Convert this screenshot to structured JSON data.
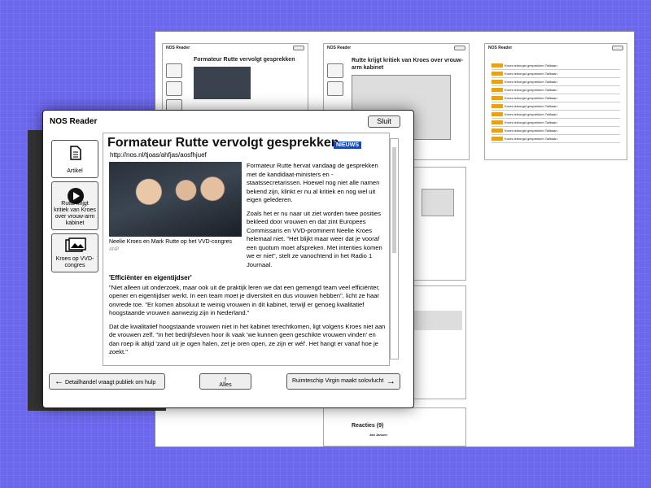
{
  "app": {
    "title": "NOS Reader",
    "close_label": "Sluit"
  },
  "sidebar": {
    "items": [
      {
        "label": "Artikel",
        "icon": "document-icon"
      },
      {
        "label": "Rutte krijgt kritiek van Kroes over vrouw-arm kabinet",
        "icon": "play-icon"
      },
      {
        "label": "Kroes op VVD-congres",
        "icon": "photos-icon"
      }
    ]
  },
  "article": {
    "title": "Formateur Rutte vervolgt gesprekken",
    "tag": "NIEUWS",
    "url": "http://nos.nl/tjoas/ahfjas/aosfhjuef",
    "caption": "Neelie Kroes en Mark Rutte op het VVD-congres",
    "source": "ANP",
    "p1": "Formateur Rutte hervat vandaag de gesprekken met de kandidaat-ministers en -staatssecretarissen. Hoewel nog niet alle namen bekend zijn, klinkt er nu al kritiek en nog wel uit eigen gelederen.",
    "p2": "Zoals het er nu naar uit ziet worden twee posities bekleed door vrouwen en dat zint Europees Commissaris en VVD-prominent Neelie Kroes helemaal niet. \"Het blijkt maar weer dat je vooraf een quotum moet afspreken. Met intenties komen we er niet\", stelt ze vanochtend in het Radio 1 Journaal.",
    "subhead": "'Efficiënter en eigentijdser'",
    "p3": "\"Niet alleen uit onderzoek, maar ook uit de praktijk leren we dat een gemengd team veel efficiënter, opener en eigentijdser werkt. In een team moet je diversiteit en dus vrouwen hebben\", licht ze haar onvrede toe. \"Er komen absoluut te weinig vrouwen in dit kabinet, terwijl er genoeg kwalitatief hoogstaande vrouwen aanwezig zijn in Nederland.\"",
    "p4": "Dat die kwalitatief hoogstaande vrouwen niet in het kabinet terechtkomen, ligt volgens Kroes niet aan de vrouwen zelf. \"In het bedrijfsleven hoor ik vaak 'we kunnen geen geschikte vrouwen vinden' en dan roep ik altijd 'zand uit je ogen halen, zet je oren open, ze zijn er wél'. Het hangt er vanaf hoe je zoekt.\""
  },
  "nav": {
    "prev": "Detailhandel vraagt publiek om hulp",
    "all": "Alles",
    "next": "Ruimteschip Virgin maakt solovlucht"
  },
  "bg": {
    "title1": "Formateur Rutte vervolgt gesprekken",
    "tag1": "NIEUWS",
    "title2": "Rutte krijgt kritiek van Kroes over vrouw-arm kabinet",
    "rows": [
      "Kroes teleurgst gesprekken Talibaan",
      "Kroes teleurgst gesprekken Talibaan",
      "Kroes teleurgst gesprekken Talibaan",
      "Kroes teleurgst gesprekken Talibaan",
      "Kroes teleurgst gesprekken Talibaan",
      "Kroes teleurgst gesprekken Talibaan",
      "Kroes teleurgst gesprekken Talibaan",
      "Kroes teleurgst gesprekken Talibaan",
      "Kroes teleurgst gesprekken Talibaan",
      "Kroes teleurgst gesprekken Talibaan"
    ],
    "reacties": "Reacties (9)",
    "author": "Jan Jansen",
    "nav_next": "Ruimteschip Virgin maakt solovlucht"
  }
}
